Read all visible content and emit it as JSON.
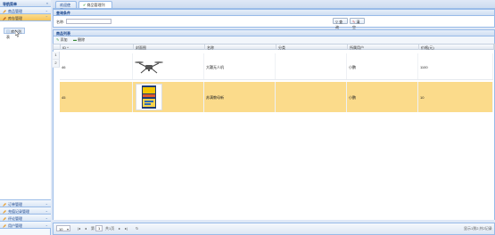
{
  "sidebar": {
    "title": "导航菜单",
    "sections": [
      {
        "label": "商品管理"
      },
      {
        "label": "库存管理"
      }
    ],
    "active_link": "库存列表",
    "bottom_sections": [
      {
        "label": "订单管理"
      },
      {
        "label": "充值记录管理"
      },
      {
        "label": "评论管理"
      },
      {
        "label": "用户管理"
      }
    ]
  },
  "tabs": [
    {
      "label": "欢迎使用"
    },
    {
      "label": "商品管理列表"
    }
  ],
  "query": {
    "title": "查询条件",
    "name_label": "名称:",
    "name_value": "",
    "search_label": "查询",
    "clear_label": "清空"
  },
  "grid": {
    "title": "商品列表",
    "add_label": "添加",
    "delete_label": "删除",
    "columns": [
      "ID ^",
      "封面图",
      "名称",
      "分类",
      "所属用户",
      "价格(元)"
    ],
    "blank_rows": [
      "1",
      "2"
    ],
    "rows": [
      {
        "id": "46",
        "name": "大疆无人机",
        "category": "",
        "owner": "小鹏",
        "price": "1100"
      },
      {
        "id": "45",
        "name": "苏满教母新",
        "category": "",
        "owner": "小鹏",
        "price": "10"
      }
    ]
  },
  "pager": {
    "page_size": "10",
    "page_prefix": "第",
    "page_value": "1",
    "page_suffix": "共1页",
    "summary": "显示1到2,共2记录"
  },
  "colors": {
    "accent": "#99bbe8",
    "selected_row": "#fbdb8b",
    "header_text": "#15428b"
  }
}
